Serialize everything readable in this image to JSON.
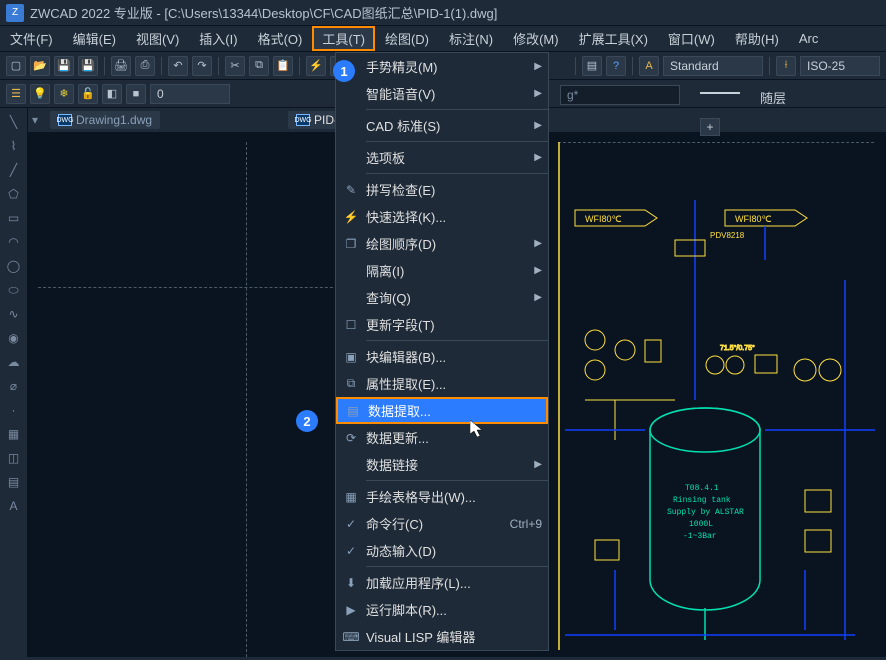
{
  "app": {
    "title": "ZWCAD 2022 专业版 - [C:\\Users\\13344\\Desktop\\CF\\CAD图纸汇总\\PID-1(1).dwg]"
  },
  "menubar": {
    "items": [
      {
        "label": "文件(F)"
      },
      {
        "label": "编辑(E)"
      },
      {
        "label": "视图(V)"
      },
      {
        "label": "插入(I)"
      },
      {
        "label": "格式(O)"
      },
      {
        "label": "工具(T)",
        "active": true
      },
      {
        "label": "绘图(D)"
      },
      {
        "label": "标注(N)"
      },
      {
        "label": "修改(M)"
      },
      {
        "label": "扩展工具(X)"
      },
      {
        "label": "窗口(W)"
      },
      {
        "label": "帮助(H)"
      },
      {
        "label": "Arc"
      }
    ]
  },
  "toolbar1": {
    "style_combo": "Standard",
    "dim_combo": "ISO-25"
  },
  "toolbar2": {
    "layer_input": "0",
    "search_placeholder": "g*",
    "layer_label": "随层"
  },
  "doctabs": {
    "tab1": "Drawing1.dwg",
    "tab2": "PID-1"
  },
  "dropdown": {
    "items": [
      {
        "label": "手势精灵(M)",
        "arrow": true
      },
      {
        "label": "智能语音(V)",
        "arrow": true
      },
      {
        "sep": true
      },
      {
        "label": "CAD 标准(S)",
        "arrow": true
      },
      {
        "sep": true
      },
      {
        "label": "选项板",
        "arrow": true
      },
      {
        "sep": true
      },
      {
        "label": "拼写检查(E)",
        "icon": "spell"
      },
      {
        "label": "快速选择(K)...",
        "icon": "qselect"
      },
      {
        "label": "绘图顺序(D)",
        "arrow": true,
        "icon": "order"
      },
      {
        "label": "隔离(I)",
        "arrow": true
      },
      {
        "label": "查询(Q)",
        "arrow": true
      },
      {
        "label": "更新字段(T)",
        "icon": "field"
      },
      {
        "sep": true
      },
      {
        "label": "块编辑器(B)...",
        "icon": "block"
      },
      {
        "label": "属性提取(E)...",
        "icon": "attr"
      },
      {
        "label": "数据提取...",
        "icon": "data",
        "highlight": true
      },
      {
        "label": "数据更新...",
        "icon": "refresh"
      },
      {
        "label": "数据链接",
        "arrow": true
      },
      {
        "sep": true
      },
      {
        "label": "手绘表格导出(W)...",
        "icon": "table"
      },
      {
        "label": "命令行(C)",
        "shortcut": "Ctrl+9",
        "icon": "cmd"
      },
      {
        "label": "动态输入(D)",
        "icon": "dynin"
      },
      {
        "sep": true
      },
      {
        "label": "加载应用程序(L)...",
        "icon": "load"
      },
      {
        "label": "运行脚本(R)...",
        "icon": "script"
      },
      {
        "label": "Visual LISP 编辑器",
        "icon": "lisp"
      }
    ]
  },
  "badges": {
    "one": "1",
    "two": "2"
  },
  "schematic": {
    "wfi1": "WFI80℃",
    "wfi2": "WFI80℃",
    "valve": "PDV8218",
    "tag1": "71.5°/0.75°",
    "tank_line1": "T08.4.1",
    "tank_line2": "Rinsing tank",
    "tank_line3": "Supply by ALSTAR",
    "tank_line4": "1000L",
    "tank_line5": "-1~3Bar"
  }
}
